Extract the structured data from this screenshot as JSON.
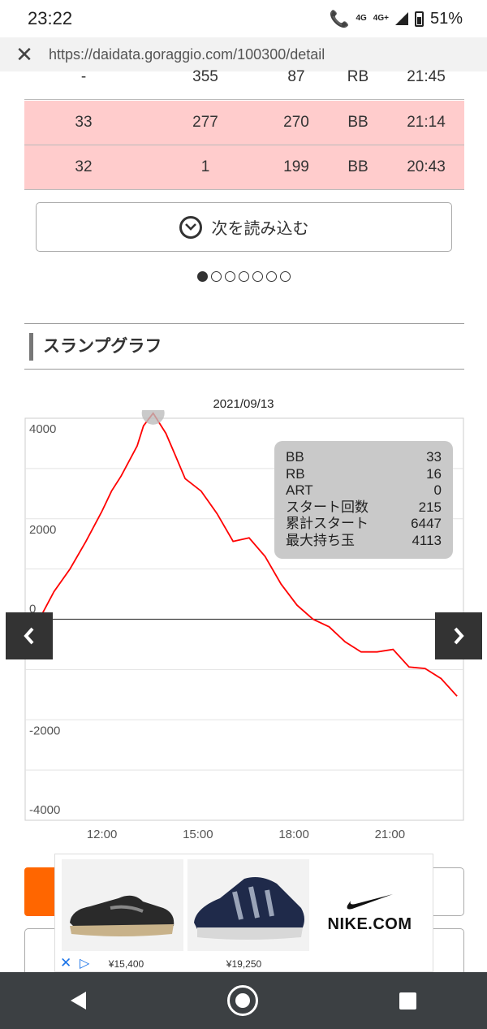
{
  "status_bar": {
    "time": "23:22",
    "network_small": "4G",
    "network": "4G+",
    "battery": "51%"
  },
  "browser": {
    "close_icon": "close-icon",
    "url": "https://daidata.goraggio.com/100300/detail"
  },
  "history_table": {
    "rows": [
      {
        "c1": "-",
        "c2": "355",
        "c3": "87",
        "c4": "RB",
        "c5": "21:45",
        "highlight": false
      },
      {
        "c1": "33",
        "c2": "277",
        "c3": "270",
        "c4": "BB",
        "c5": "21:14",
        "highlight": true
      },
      {
        "c1": "32",
        "c2": "1",
        "c3": "199",
        "c4": "BB",
        "c5": "20:43",
        "highlight": true
      }
    ]
  },
  "load_more": {
    "label": "次を読み込む",
    "icon": "chevron-down-circle-icon"
  },
  "pagination": {
    "total": 7,
    "active": 1
  },
  "slump_section": {
    "heading": "スランプグラフ"
  },
  "chart_data": {
    "type": "line",
    "title": "2021/09/13",
    "ylim": [
      -4000,
      4000
    ],
    "y_ticks": [
      "4000",
      "2000",
      "0",
      "-2000",
      "-4000"
    ],
    "x_ticks": [
      "12:00",
      "15:00",
      "18:00",
      "21:00"
    ],
    "x_range_hours": [
      9.6,
      23.3
    ],
    "grid": true,
    "color": "#ff0000",
    "series": [
      {
        "x": [
          10.0,
          10.5,
          11.0,
          11.5,
          12.0,
          12.3,
          12.6,
          13.1,
          13.3,
          13.6,
          14.0,
          14.3,
          14.6,
          15.1,
          15.6,
          16.1,
          16.6,
          17.1,
          17.6,
          18.1,
          18.6,
          19.1,
          19.6,
          20.1,
          20.6,
          21.1,
          21.6,
          22.1,
          22.6,
          23.1
        ],
        "y": [
          -50,
          550,
          1000,
          1550,
          2150,
          2550,
          2850,
          3450,
          3850,
          4100,
          3700,
          3250,
          2800,
          2550,
          2100,
          1550,
          1620,
          1250,
          700,
          280,
          0,
          -150,
          -450,
          -650,
          -650,
          -600,
          -950,
          -980,
          -1180,
          -1530
        ]
      }
    ],
    "peak_marker": {
      "x": 13.6,
      "y": 4100
    }
  },
  "tooltip": {
    "rows": [
      {
        "label": "BB",
        "value": "33"
      },
      {
        "label": "RB",
        "value": "16"
      },
      {
        "label": "ART",
        "value": "0"
      },
      {
        "label": "スタート回数",
        "value": "215"
      },
      {
        "label": "累計スタート",
        "value": "6447"
      },
      {
        "label": "最大持ち玉",
        "value": "4113"
      }
    ]
  },
  "chart_nav": {
    "prev_icon": "chevron-left-icon",
    "next_icon": "chevron-right-icon"
  },
  "ad": {
    "items": [
      {
        "price": "¥15,400",
        "icon": "shoe-trail-image"
      },
      {
        "price": "¥19,250",
        "icon": "shoe-uptempo-image"
      },
      {
        "brand": "NIKE.COM",
        "icon": "nike-swoosh-icon"
      }
    ],
    "close_icon": "ad-close-icon",
    "adchoices_icon": "adchoices-icon"
  },
  "system_nav": {
    "back": "back-icon",
    "home": "home-icon",
    "recents": "recents-icon"
  }
}
